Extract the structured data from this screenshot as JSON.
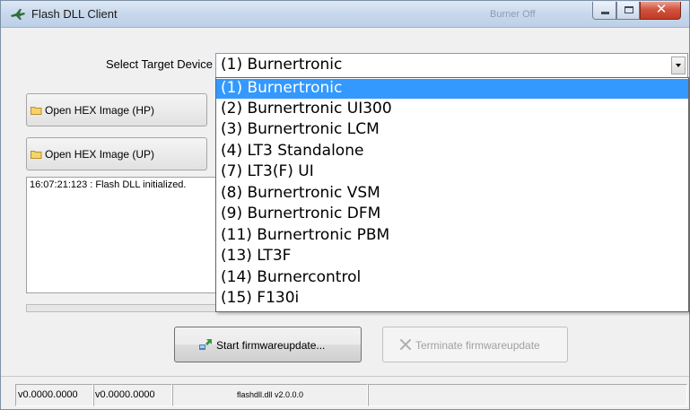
{
  "window": {
    "title": "Flash DLL Client",
    "title_status": "Burner Off",
    "close_glyph": "✕"
  },
  "target": {
    "label": "Select Target Device",
    "selected": "(1) Burnertronic"
  },
  "devices": [
    "(1) Burnertronic",
    "(2) Burnertronic UI300",
    "(3) Burnertronic LCM",
    "(4) LT3 Standalone",
    "(7) LT3(F) UI",
    "(8) Burnertronic VSM",
    "(9) Burnertronic DFM",
    "(11) Burnertronic PBM",
    "(13) LT3F",
    "(14) Burnercontrol",
    "(15) F130i"
  ],
  "selected_index": 0,
  "buttons": {
    "open_hp": "Open HEX Image (HP)",
    "open_up": "Open HEX Image (UP)",
    "start": "Start firmwareupdate...",
    "terminate": "Terminate firmwareupdate"
  },
  "log": {
    "line1": "16:07:21:123 : Flash DLL initialized."
  },
  "status": {
    "version1": "v0.0000.0000",
    "version2": "v0.0000.0000",
    "dll": "flashdll.dll v2.0.0.0",
    "empty": ""
  },
  "colors": {
    "selection": "#3399ff",
    "titlebar": "#c9d9ec",
    "close_button": "#c13a22"
  },
  "icons": {
    "app": "plane-icon",
    "folder": "folder-icon",
    "start": "update-icon",
    "terminate": "stop-icon"
  }
}
